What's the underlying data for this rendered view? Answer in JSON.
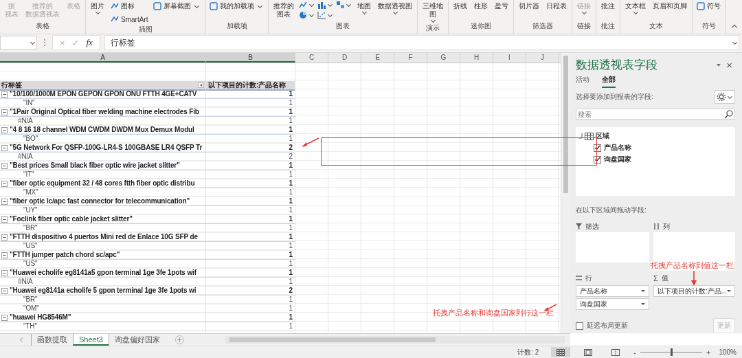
{
  "ribbon": {
    "groups": [
      {
        "label": "表格",
        "buttons": [
          {
            "kind": "large",
            "lines": [
              "据",
              "视表"
            ],
            "disabled": true
          },
          {
            "kind": "large",
            "lines": [
              "推荐的",
              "数据透视表"
            ],
            "disabled": true
          },
          {
            "kind": "large",
            "lines": [
              "表格"
            ],
            "disabled": true
          }
        ]
      },
      {
        "label": "插图",
        "buttons": [
          {
            "kind": "large",
            "lines": [
              "图片"
            ],
            "disabled": false,
            "caret": true
          },
          {
            "kind": "stack",
            "items": [
              {
                "label": "图标"
              },
              {
                "label": "SmartArt"
              }
            ]
          },
          {
            "kind": "small",
            "label": "屏幕截图",
            "disabled": false,
            "caret": true
          }
        ]
      },
      {
        "label": "加载项",
        "buttons": [
          {
            "kind": "small",
            "label": "我的加载项",
            "disabled": false,
            "caret": true
          }
        ]
      },
      {
        "label": "图表",
        "buttons": [
          {
            "kind": "large",
            "lines": [
              "推荐的",
              "图表"
            ],
            "disabled": false
          },
          {
            "kind": "chart_gallery"
          },
          {
            "kind": "large",
            "lines": [
              "地图"
            ],
            "disabled": false,
            "caret": true
          },
          {
            "kind": "large",
            "lines": [
              "数据透视图"
            ],
            "disabled": false,
            "caret": true
          }
        ]
      },
      {
        "label": "演示",
        "buttons": [
          {
            "kind": "large",
            "lines": [
              "三维地",
              "图"
            ],
            "disabled": false,
            "caret": true
          }
        ]
      },
      {
        "label": "迷你图",
        "buttons": [
          {
            "kind": "large",
            "lines": [
              "折线"
            ],
            "disabled": false
          },
          {
            "kind": "large",
            "lines": [
              "柱形"
            ],
            "disabled": false
          },
          {
            "kind": "large",
            "lines": [
              "盈亏"
            ],
            "disabled": false
          }
        ]
      },
      {
        "label": "筛选器",
        "buttons": [
          {
            "kind": "large",
            "lines": [
              "切片器"
            ],
            "disabled": false
          },
          {
            "kind": "large",
            "lines": [
              "日程表"
            ],
            "disabled": false
          }
        ]
      },
      {
        "label": "链接",
        "buttons": [
          {
            "kind": "large",
            "lines": [
              "链接"
            ],
            "disabled": true,
            "caret": true
          }
        ]
      },
      {
        "label": "批注",
        "buttons": [
          {
            "kind": "large",
            "lines": [
              "批注"
            ],
            "disabled": false
          }
        ]
      },
      {
        "label": "文本",
        "buttons": [
          {
            "kind": "large",
            "lines": [
              "文本框"
            ],
            "disabled": false,
            "caret": true
          },
          {
            "kind": "large",
            "lines": [
              "页眉和页脚"
            ],
            "disabled": false
          }
        ]
      },
      {
        "label": "符号",
        "buttons": [
          {
            "kind": "small",
            "label": "符号",
            "disabled": false
          }
        ]
      }
    ]
  },
  "formula_bar": {
    "cancel": "×",
    "enter": "✓",
    "function": "fx",
    "value": "行标签"
  },
  "sheet": {
    "columns": [
      "A",
      "B",
      "C",
      "D",
      "E",
      "F",
      "G",
      "H",
      "I",
      "J"
    ],
    "pivot": {
      "row_header": "行标签",
      "value_header": "以下项目的计数:产品名称",
      "rows": [
        {
          "label": "\"10/100/1000M EPON GEPON GPON ONU FTTH 4GE+CATV",
          "value": "1",
          "expanded": true,
          "children": [
            {
              "label": "\"IN\"",
              "value": "1"
            }
          ]
        },
        {
          "label": "\"1Pair Original Optical fiber welding machine electrodes Fib",
          "value": "1",
          "expanded": true,
          "children": [
            {
              "label": "#N/A",
              "value": "1"
            }
          ]
        },
        {
          "label": "\"4 8 16 18 channel WDM CWDM DWDM Mux Demux Modul",
          "value": "1",
          "expanded": true,
          "children": [
            {
              "label": "\"BO\"",
              "value": "1"
            }
          ]
        },
        {
          "label": "\"5G Network For QSFP-100G-LR4-S 100GBASE LR4 QSFP Tr",
          "value": "2",
          "expanded": true,
          "children": [
            {
              "label": "#N/A",
              "value": "2"
            }
          ]
        },
        {
          "label": "\"Best prices Small black fiber optic wire jacket slitter\"",
          "value": "1",
          "expanded": true,
          "children": [
            {
              "label": "\"IT\"",
              "value": "1"
            }
          ]
        },
        {
          "label": "\"fiber optic equipment 32 / 48 cores ftth fiber optic distribu",
          "value": "1",
          "expanded": true,
          "children": [
            {
              "label": "\"MX\"",
              "value": "1"
            }
          ]
        },
        {
          "label": "\"fiber optic lc/apc fast connector for telecommunication\"",
          "value": "1",
          "expanded": true,
          "children": [
            {
              "label": "\"UY\"",
              "value": "1"
            }
          ]
        },
        {
          "label": "\"Foclink fiber optic cable jacket slitter\"",
          "value": "1",
          "expanded": true,
          "children": [
            {
              "label": "\"BR\"",
              "value": "1"
            }
          ]
        },
        {
          "label": "\"FTTH dispositivo 4 puertos Mini red de Enlace 10G SFP de",
          "value": "1",
          "expanded": true,
          "children": [
            {
              "label": "\"US\"",
              "value": "1"
            }
          ]
        },
        {
          "label": "\"FTTH jumper patch chord sc/apc\"",
          "value": "1",
          "expanded": true,
          "children": [
            {
              "label": "\"US\"",
              "value": "1"
            }
          ]
        },
        {
          "label": "\"Huawei echolife eg8141a5 gpon terminal 1ge 3fe 1pots wif",
          "value": "1",
          "expanded": true,
          "children": [
            {
              "label": "#N/A",
              "value": "1"
            }
          ]
        },
        {
          "label": "\"Huawei eg8141a echolife 5 gpon terminal 1ge 3fe 1pots wi",
          "value": "2",
          "expanded": true,
          "children": [
            {
              "label": "\"BR\"",
              "value": "1"
            },
            {
              "label": "\"OM\"",
              "value": "1"
            }
          ]
        },
        {
          "label": "\"huawei HG8546M\"",
          "value": "1",
          "expanded": true,
          "children": [
            {
              "label": "\"TH\"",
              "value": "1"
            }
          ]
        }
      ]
    },
    "annotation": "托拽产品名称和询盘国家到行这一栏"
  },
  "sheet_tabs": [
    {
      "label": "函数提取",
      "selected": false
    },
    {
      "label": "Sheet3",
      "selected": true
    },
    {
      "label": "询盘偏好国家",
      "selected": false
    }
  ],
  "pane": {
    "title": "数据透视表字段",
    "close": "×",
    "tabs": [
      {
        "label": "活动",
        "selected": false
      },
      {
        "label": "全部",
        "selected": true
      }
    ],
    "choose_label": "选择要添加到报表的字段:",
    "search": {
      "placeholder": "搜索"
    },
    "table": "区域",
    "fields": [
      {
        "label": "产品名称",
        "checked": true
      },
      {
        "label": "询盘国家",
        "checked": true
      }
    ],
    "drag_label": "在以下区域间拖动字段:",
    "areas": [
      {
        "kind": "filter",
        "title": "筛选"
      },
      {
        "kind": "columns",
        "title": "列"
      },
      {
        "kind": "rows",
        "title": "行",
        "items": [
          {
            "label": "产品名称"
          },
          {
            "label": "询盘国家"
          }
        ]
      },
      {
        "kind": "values",
        "symbol": "Σ",
        "title": "值",
        "items": [
          {
            "label": "以下项目的计数:产品..."
          }
        ]
      }
    ],
    "annotation": "托拽产品名称到值这一栏",
    "defer": {
      "label": "延迟布局更新",
      "checked": false
    },
    "update": {
      "label": "更新",
      "disabled": true
    }
  },
  "status_bar": {
    "count": "计数: 2",
    "views": [
      {
        "kind": "normal",
        "selected": true
      },
      {
        "kind": "layout",
        "selected": false
      },
      {
        "kind": "break",
        "selected": false
      }
    ],
    "zoom": {
      "minus": "-",
      "plus": "+",
      "level": 0.5,
      "reading": "100%"
    }
  }
}
